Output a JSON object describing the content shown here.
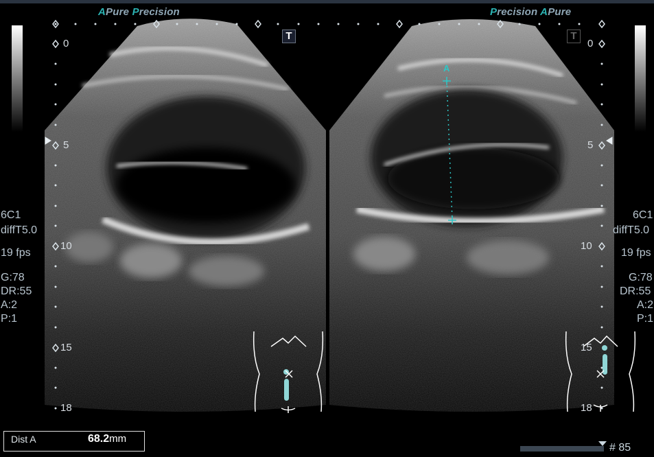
{
  "branding": {
    "left": {
      "a": "A",
      "pure": "Pure",
      "a2": "P",
      "precision": "recision"
    },
    "right": {
      "p": "P",
      "precision": "recision",
      "a": "A",
      "pure": "Pure"
    }
  },
  "toolbar": {
    "left_t_label": "T",
    "right_t_label": "T"
  },
  "depth_scale": {
    "labels": [
      "0",
      "5",
      "10",
      "15",
      "18"
    ]
  },
  "acquisition": {
    "probe": "6C1",
    "preset": "diffT5.0",
    "frame_rate": "19 fps",
    "gain": "G:78",
    "dynamic_range": "DR:55",
    "averaging": "A:2",
    "persistence": "P:1"
  },
  "measurement": {
    "label": "Dist A",
    "value": "68.2",
    "unit": "mm",
    "marker": "A"
  },
  "cine": {
    "frame_number": "# 85",
    "position": 0.98
  },
  "colors": {
    "accent": "#2bb3b3",
    "caliper": "#2ec7c7",
    "background": "#000000"
  }
}
